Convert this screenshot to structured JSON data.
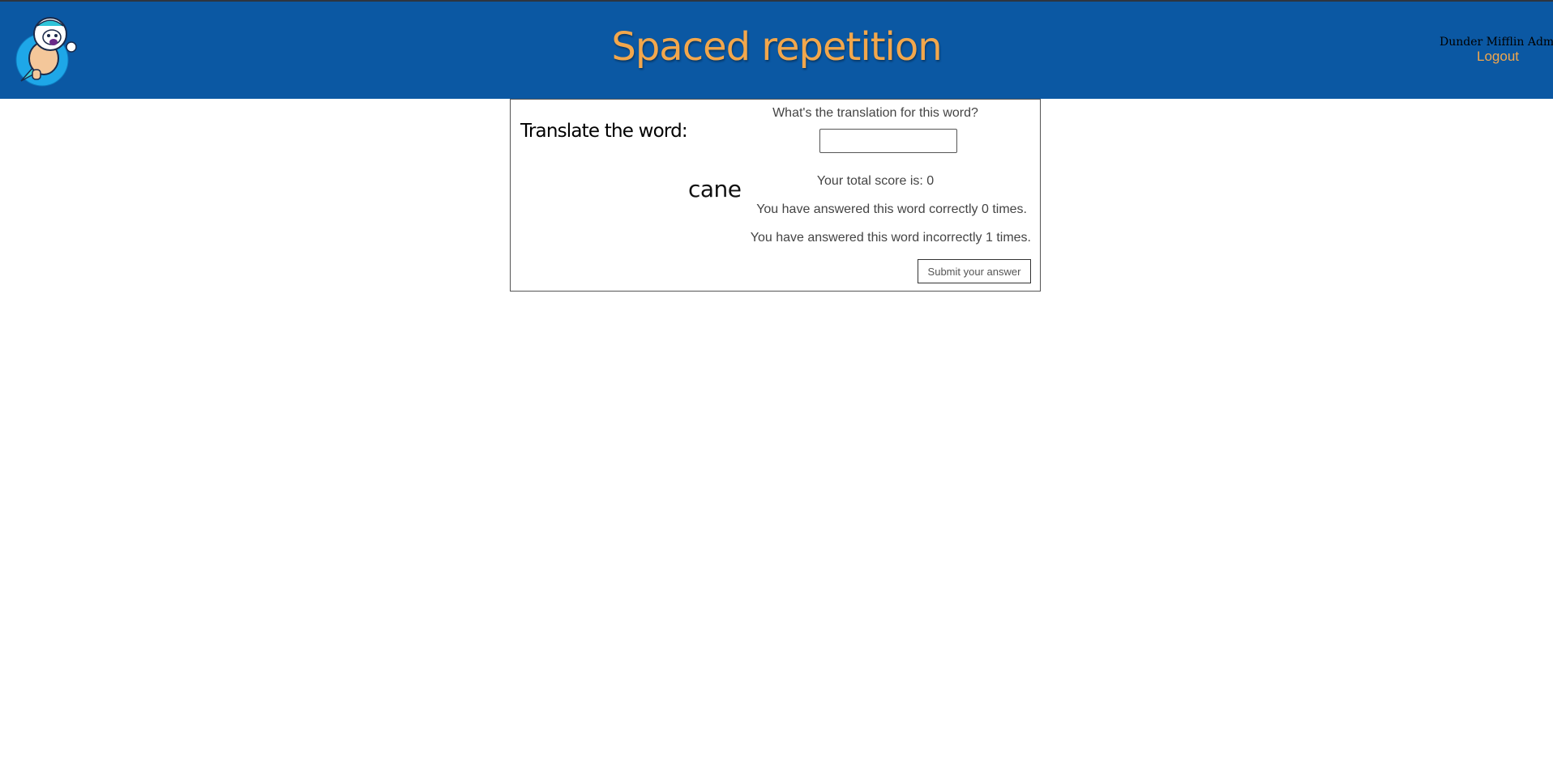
{
  "header": {
    "title": "Spaced repetition",
    "user_name": "Dunder Mifflin Admin",
    "logout_label": "Logout",
    "logo_icon": "astronaut-logo-icon"
  },
  "learning": {
    "heading": "Translate the word:",
    "word": "cane",
    "prompt": "What's the translation for this word?",
    "answer_value": "",
    "score_text": "Your total score is: 0",
    "correct_text": "You have answered this word correctly 0 times.",
    "incorrect_text": "You have answered this word incorrectly 1 times.",
    "submit_label": "Submit your answer"
  },
  "colors": {
    "header_bg": "#0b58a3",
    "accent": "#f2a74c",
    "text": "#444444"
  }
}
